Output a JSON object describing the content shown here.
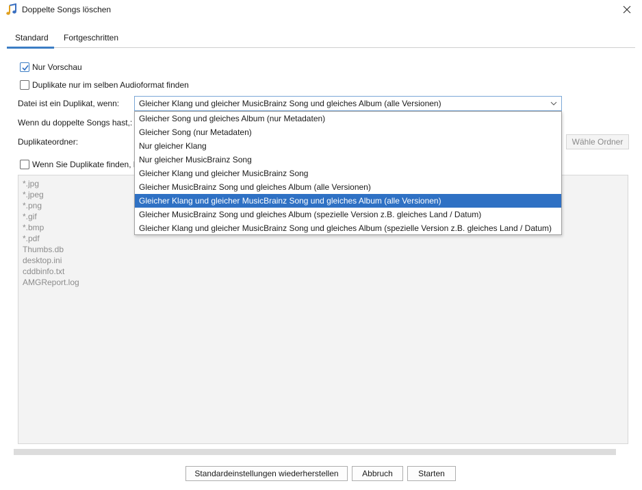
{
  "window": {
    "title": "Doppelte Songs löschen"
  },
  "tabs": [
    {
      "label": "Standard",
      "active": true
    },
    {
      "label": "Fortgeschritten",
      "active": false
    }
  ],
  "options": {
    "preview_only": {
      "label": "Nur Vorschau",
      "checked": true
    },
    "same_format": {
      "label": "Duplikate nur im selben Audioformat finden",
      "checked": false
    },
    "when_found": {
      "label": "Wenn Sie Duplikate finden, l",
      "checked": false
    }
  },
  "fields": {
    "duplicate_if_label": "Datei ist ein Duplikat, wenn:",
    "when_duplicate_label": "Wenn du doppelte Songs hast,:",
    "folder_label": "Duplikateordner:",
    "choose_folder_button": "Wähle Ordner"
  },
  "combo": {
    "value": "Gleicher Klang und gleicher MusicBrainz Song und gleiches Album (alle Versionen)",
    "items": [
      "Gleicher Song und gleiches Album (nur Metadaten)",
      "Gleicher Song (nur Metadaten)",
      "Nur gleicher Klang",
      "Nur gleicher MusicBrainz Song",
      "Gleicher Klang und gleicher MusicBrainz Song",
      "Gleicher MusicBrainz Song und gleiches Album (alle Versionen)",
      "Gleicher Klang und gleicher MusicBrainz Song und gleiches Album (alle Versionen)",
      "Gleicher MusicBrainz Song und gleiches Album (spezielle Version z.B. gleiches Land / Datum)",
      "Gleicher Klang und gleicher MusicBrainz Song und gleiches Album (spezielle Version z.B. gleiches Land / Datum)"
    ],
    "selected_index": 6
  },
  "excluded_files": [
    "*.jpg",
    "*.jpeg",
    "*.png",
    "*.gif",
    "*.bmp",
    "*.pdf",
    "Thumbs.db",
    "desktop.ini",
    "cddbinfo.txt",
    "AMGReport.log"
  ],
  "buttons": {
    "reset": "Standardeinstellungen wiederherstellen",
    "cancel": "Abbruch",
    "start": "Starten"
  },
  "colors": {
    "accent": "#2f71c4",
    "tab_underline": "#3b7dc4"
  }
}
